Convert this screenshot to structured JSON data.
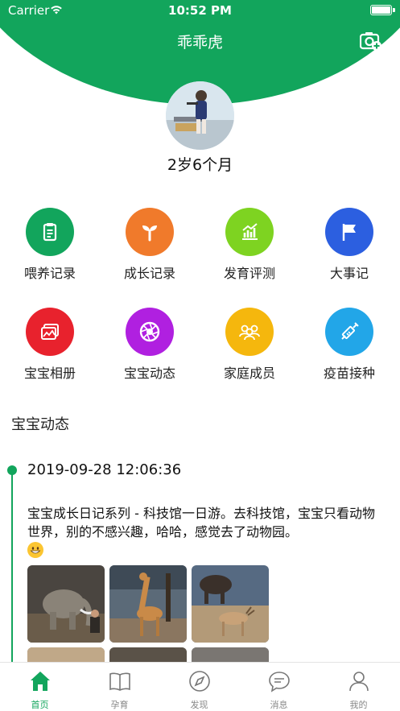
{
  "status_bar": {
    "carrier": "Carrier",
    "time": "10:52 PM"
  },
  "header": {
    "title": "乖乖虎",
    "camera_icon": "camera-add-icon"
  },
  "profile": {
    "age": "2岁6个月"
  },
  "features": [
    {
      "label": "喂养记录",
      "icon": "clipboard-icon",
      "color": "#12a55c"
    },
    {
      "label": "成长记录",
      "icon": "sprout-icon",
      "color": "#f07a2b"
    },
    {
      "label": "发育评测",
      "icon": "chart-icon",
      "color": "#7ed321"
    },
    {
      "label": "大事记",
      "icon": "flag-icon",
      "color": "#2c5fe0"
    },
    {
      "label": "宝宝相册",
      "icon": "photo-album-icon",
      "color": "#e8222d"
    },
    {
      "label": "宝宝动态",
      "icon": "aperture-icon",
      "color": "#b020e0"
    },
    {
      "label": "家庭成员",
      "icon": "family-icon",
      "color": "#f5b70d"
    },
    {
      "label": "疫苗接种",
      "icon": "syringe-icon",
      "color": "#22a6e8"
    }
  ],
  "feed": {
    "section_title": "宝宝动态",
    "post": {
      "date": "2019-09-28 12:06:36",
      "text": "宝宝成长日记系列 - 科技馆一日游。去科技馆，宝宝只看动物世界，别的不感兴趣，哈哈，感觉去了动物园。"
    }
  },
  "tabbar": [
    {
      "label": "首页",
      "icon": "home-icon",
      "active": true
    },
    {
      "label": "孕育",
      "icon": "book-icon",
      "active": false
    },
    {
      "label": "发现",
      "icon": "compass-icon",
      "active": false
    },
    {
      "label": "消息",
      "icon": "message-icon",
      "active": false
    },
    {
      "label": "我的",
      "icon": "user-icon",
      "active": false
    }
  ],
  "colors": {
    "brand": "#12a55c",
    "tab_inactive": "#888888"
  }
}
